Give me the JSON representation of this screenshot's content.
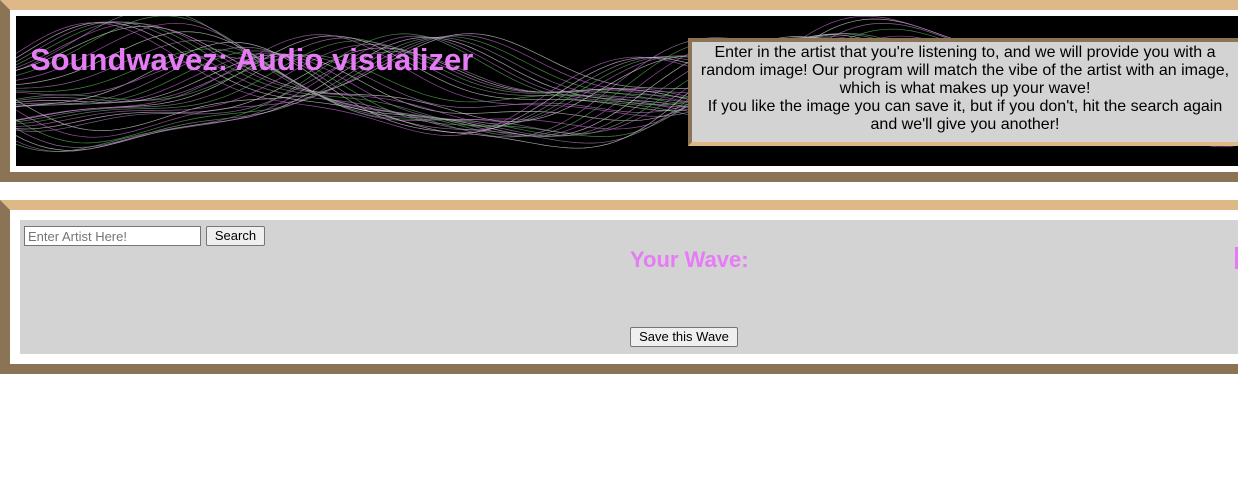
{
  "header": {
    "title": "Soundwavez: Audio visualizer",
    "info_paragraph_1": "Enter in the artist that you're listening to, and we will provide you with a random image! Our program will match the vibe of the artist with an image, which is what makes up your wave!",
    "info_paragraph_2": "If you like the image you can save it, but if you don't, hit the search again and we'll give you another!"
  },
  "search": {
    "placeholder": "Enter Artist Here!",
    "value": "",
    "button_label": "Search"
  },
  "wave": {
    "heading": "Your Wave:",
    "save_label": "Save this Wave"
  },
  "colors": {
    "accent_pink": "#e67cf5",
    "frame_light": "#deb887",
    "frame_dark": "#8b7355",
    "panel_bg": "#d3d3d3"
  }
}
